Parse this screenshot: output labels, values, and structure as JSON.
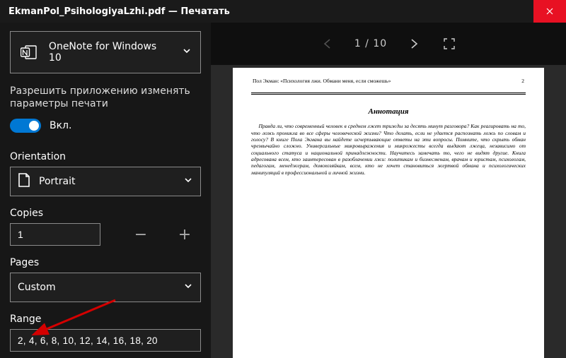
{
  "window": {
    "title": "EkmanPol_PsihologiyaLzhi.pdf — Печатать"
  },
  "sidebar": {
    "printer": "OneNote for Windows 10",
    "allow_change_text": "Разрешить приложению изменять параметры печати",
    "toggle_label": "Вкл.",
    "orientation_label": "Orientation",
    "orientation_value": "Portrait",
    "copies_label": "Copies",
    "copies_value": "1",
    "pages_label": "Pages",
    "pages_value": "Custom",
    "range_label": "Range",
    "range_value": "2, 4, 6, 8, 10, 12, 14, 16, 18, 20"
  },
  "preview": {
    "current_page": "1",
    "total_pages": "10",
    "indicator_sep": " / "
  },
  "doc_preview": {
    "header_left": "Пол Экман: «Психология лжи. Обмани меня, если сможешь»",
    "header_right": "2",
    "title": "Аннотация",
    "body": "Правда ли, что современный человек в среднем лжет трижды за десять минут разговора? Как реагировать на то, что ложь проникла во все сферы человеческой жизни? Что делать, если не удается распознать ложь по словам и голосу? В книге Пола Экмана вы найдете исчерпывающие ответы на эти вопросы. Помните, что скрыть обман чрезвычайно сложно. Универсальные микровыражения и микрожесты всегда выдают лжеца, независимо от социального статуса и национальной принадлежности. Научитесь замечать то, чего не видят другие. Книга адресована всем, кто заинтересован в разоблачении лжи: политикам и бизнесменам, врачам и юристам, психологам, педагогам, менеджерам, домохозяйкам, всем, кто не хочет становиться жертвой обмана и психологических манипуляций в профессиональной и личной жизни."
  },
  "colors": {
    "close": "#e81123",
    "accent": "#0078d4"
  }
}
